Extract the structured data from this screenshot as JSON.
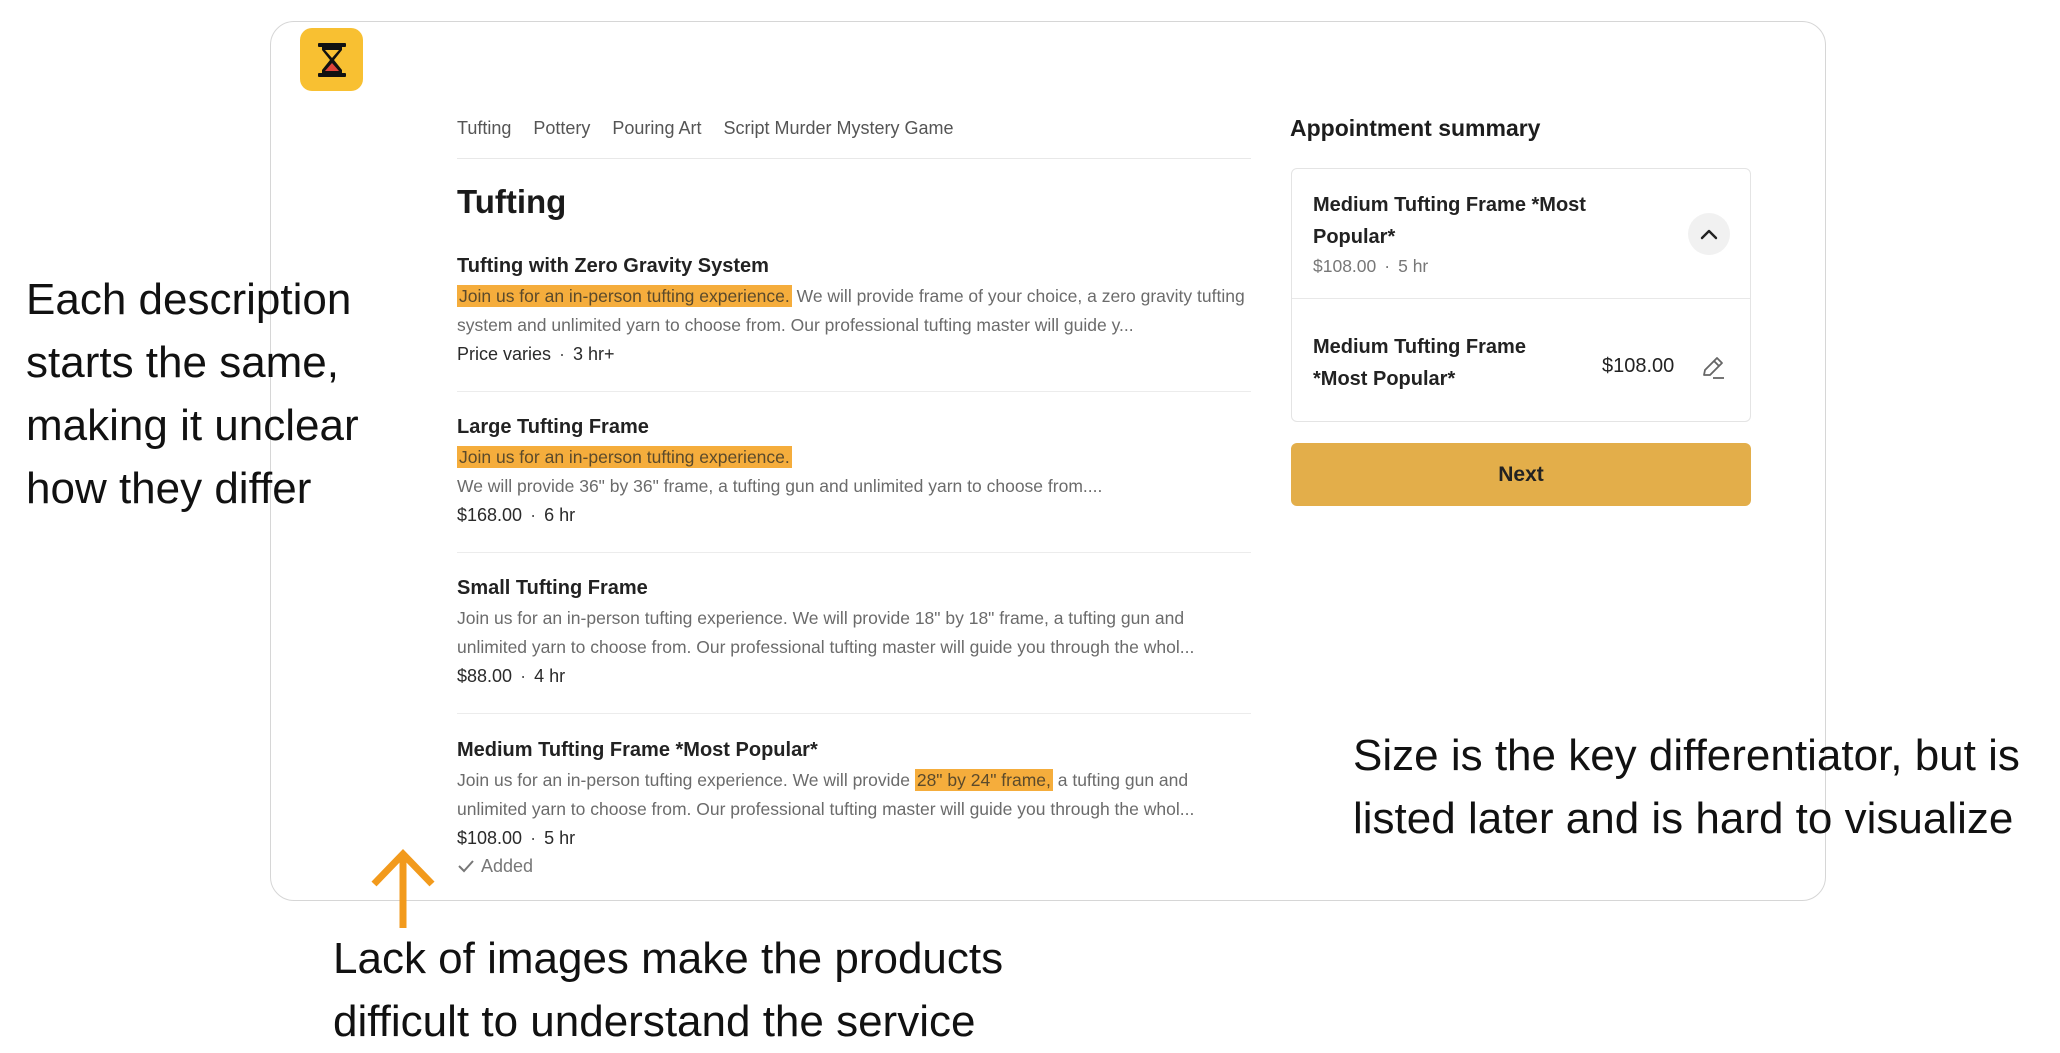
{
  "tabs": [
    "Tufting",
    "Pottery",
    "Pouring Art",
    "Script Murder Mystery Game"
  ],
  "page_title": "Tufting",
  "services": [
    {
      "title": "Tufting with Zero Gravity System",
      "desc_highlight": "Join us for an in-person tufting experience.",
      "desc_rest": " We will provide frame of your choice, a zero gravity tufting system and unlimited yarn to choose from. Our professional tufting master will guide y...",
      "price": "Price varies",
      "duration": "3 hr+"
    },
    {
      "title": "Large Tufting Frame",
      "desc_highlight": "Join us for an in-person tufting experience.",
      "desc_line2": "We will provide 36\" by 36\" frame, a tufting gun and unlimited yarn to choose from....",
      "price": "$168.00",
      "duration": "6 hr"
    },
    {
      "title": "Small Tufting Frame",
      "desc": "Join us for an in-person tufting experience. We will provide 18\" by 18\" frame, a tufting gun and unlimited yarn to choose from. Our professional tufting master will guide you through the whol...",
      "price": "$88.00",
      "duration": "4 hr"
    },
    {
      "title": "Medium Tufting Frame *Most Popular*",
      "desc_before": "Join us for an in-person tufting experience. We will provide ",
      "desc_highlight": "28\" by 24\" frame,",
      "desc_after": " a tufting gun and unlimited yarn to choose from. Our professional tufting master will guide you through the whol...",
      "price": "$108.00",
      "duration": "5 hr",
      "added_label": "Added"
    }
  ],
  "summary": {
    "title": "Appointment summary",
    "selected_name": "Medium Tufting Frame *Most Popular*",
    "selected_price": "$108.00",
    "selected_duration": "5 hr",
    "item_name": "Medium Tufting Frame *Most Popular*",
    "item_price": "$108.00",
    "next_label": "Next"
  },
  "annotations": {
    "left": "Each description starts the same, making it unclear how they differ",
    "right": "Size is the key differentiator, but is listed later and is hard to visualize",
    "bottom": "Lack of images make the products difficult to understand the service"
  },
  "colors": {
    "accent": "#f8c032",
    "highlight": "#f5ad3c",
    "next_button": "#e3ae4a",
    "arrow": "#f29a1c"
  },
  "icons": [
    "hourglass-icon",
    "chevron-up-icon",
    "pencil-icon",
    "check-icon",
    "arrow-up-icon"
  ]
}
